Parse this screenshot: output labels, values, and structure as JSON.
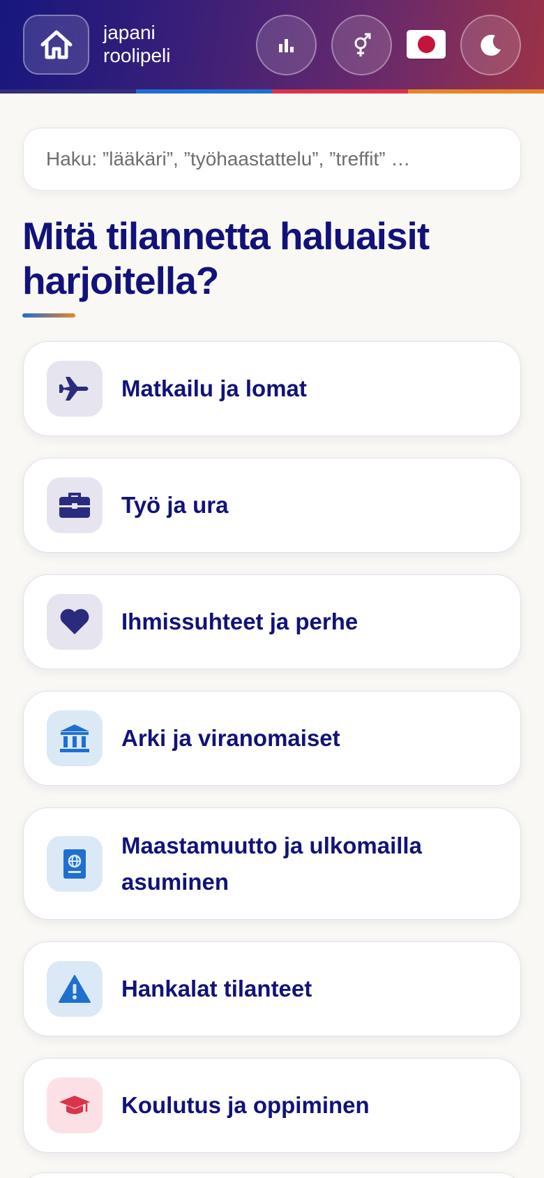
{
  "header": {
    "brand_line1": "japani",
    "brand_line2": "roolipeli",
    "home_icon": "home-icon",
    "stats_icon": "bar-chart-icon",
    "gender_icon": "gender-icon",
    "flag_icon": "japan-flag-icon",
    "theme_icon": "moon-icon",
    "stripe_colors": [
      "#32307a",
      "#1f6fd0",
      "#d8344a",
      "#e8842a"
    ]
  },
  "search": {
    "placeholder": "Haku: ”lääkäri”, ”työhaastattelu”, ”treffit” …"
  },
  "main": {
    "heading": "Mitä tilannetta haluaisit harjoitella?",
    "categories": [
      {
        "label": "Matkailu ja lomat",
        "icon": "plane-icon",
        "color": "#2b2b7e"
      },
      {
        "label": "Työ ja ura",
        "icon": "briefcase-icon",
        "color": "#2b2b7e"
      },
      {
        "label": "Ihmissuhteet ja perhe",
        "icon": "heart-icon",
        "color": "#2b2b7e"
      },
      {
        "label": "Arki ja viranomaiset",
        "icon": "bank-icon",
        "color": "#1f6fd0"
      },
      {
        "label": "Maastamuutto ja ulkomailla asuminen",
        "icon": "passport-icon",
        "color": "#1f6fd0"
      },
      {
        "label": "Hankalat tilanteet",
        "icon": "warning-icon",
        "color": "#1f6fd0"
      },
      {
        "label": "Koulutus ja oppiminen",
        "icon": "graduation-cap-icon",
        "color": "#d8344a"
      }
    ]
  }
}
